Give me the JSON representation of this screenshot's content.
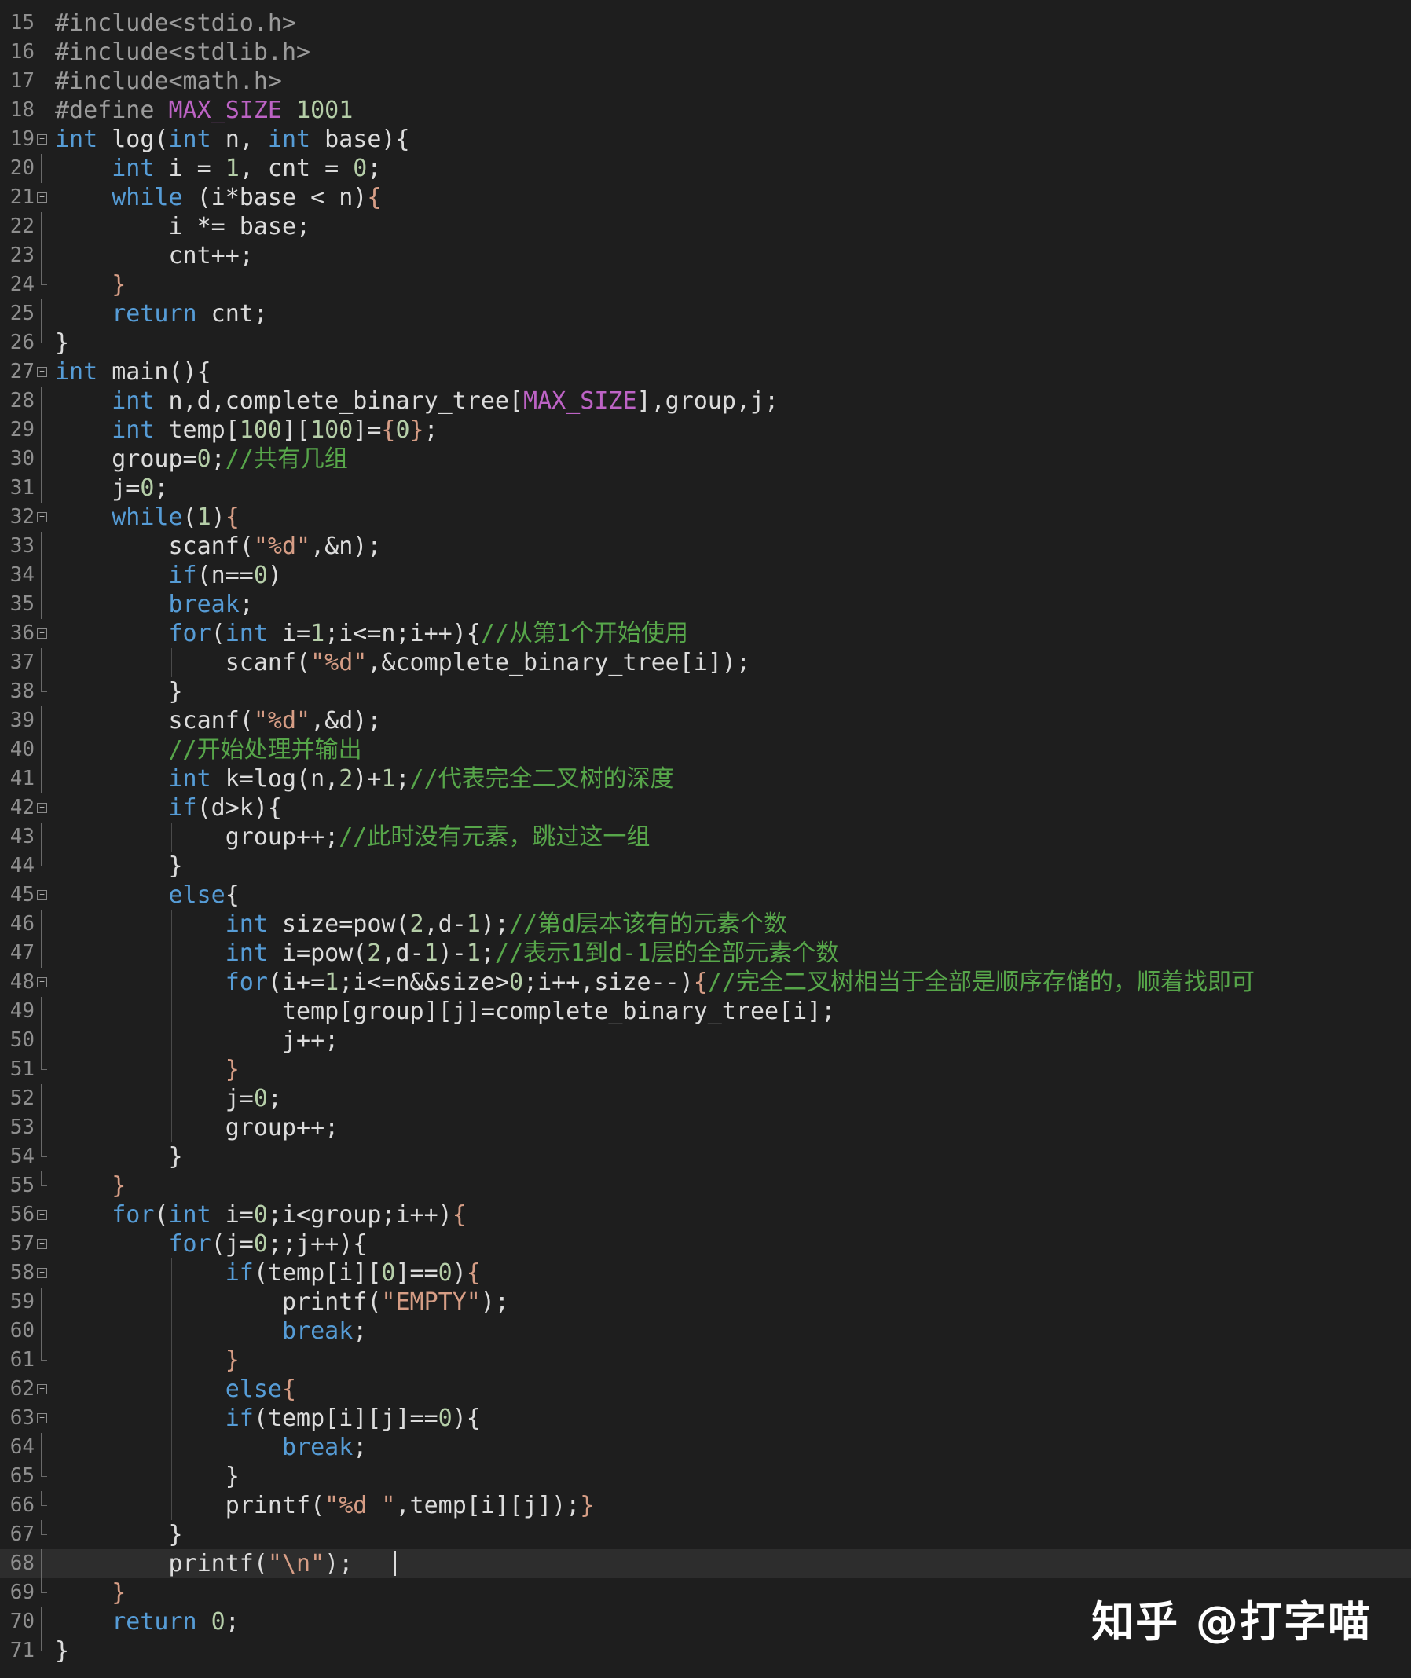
{
  "editor": {
    "lines": [
      {
        "num": "15",
        "fold": "",
        "indent": 0,
        "segments": [
          [
            "pr",
            "#include<stdio.h>"
          ]
        ]
      },
      {
        "num": "16",
        "fold": "",
        "indent": 0,
        "segments": [
          [
            "pr",
            "#include<stdlib.h>"
          ]
        ]
      },
      {
        "num": "17",
        "fold": "",
        "indent": 0,
        "segments": [
          [
            "pr",
            "#include<math.h>"
          ]
        ]
      },
      {
        "num": "18",
        "fold": "",
        "indent": 0,
        "segments": [
          [
            "pr",
            "#define "
          ],
          [
            "m",
            "MAX_SIZE"
          ],
          [
            "pr",
            " "
          ],
          [
            "n",
            "1001"
          ]
        ]
      },
      {
        "num": "19",
        "fold": "open",
        "indent": 0,
        "segments": [
          [
            "k",
            "int"
          ],
          [
            "t",
            " log("
          ],
          [
            "k",
            "int"
          ],
          [
            "t",
            " n, "
          ],
          [
            "k",
            "int"
          ],
          [
            "t",
            " base){"
          ]
        ]
      },
      {
        "num": "20",
        "fold": "bar",
        "indent": 1,
        "segments": [
          [
            "k",
            "int"
          ],
          [
            "t",
            " i = "
          ],
          [
            "n",
            "1"
          ],
          [
            "t",
            ", cnt = "
          ],
          [
            "n",
            "0"
          ],
          [
            "t",
            ";"
          ]
        ]
      },
      {
        "num": "21",
        "fold": "open",
        "indent": 1,
        "segments": [
          [
            "k",
            "while"
          ],
          [
            "t",
            " (i*base < n)"
          ],
          [
            "s",
            "{"
          ]
        ]
      },
      {
        "num": "22",
        "fold": "bar",
        "indent": 2,
        "segments": [
          [
            "t",
            "i *= base;"
          ]
        ]
      },
      {
        "num": "23",
        "fold": "bar",
        "indent": 2,
        "segments": [
          [
            "t",
            "cnt++;"
          ]
        ]
      },
      {
        "num": "24",
        "fold": "end",
        "indent": 1,
        "segments": [
          [
            "s",
            "}"
          ]
        ]
      },
      {
        "num": "25",
        "fold": "bar",
        "indent": 1,
        "segments": [
          [
            "k",
            "return"
          ],
          [
            "t",
            " cnt;"
          ]
        ]
      },
      {
        "num": "26",
        "fold": "end",
        "indent": 0,
        "segments": [
          [
            "t",
            "}"
          ]
        ]
      },
      {
        "num": "27",
        "fold": "open",
        "indent": 0,
        "segments": [
          [
            "k",
            "int"
          ],
          [
            "t",
            " main(){"
          ]
        ]
      },
      {
        "num": "28",
        "fold": "bar",
        "indent": 1,
        "segments": [
          [
            "k",
            "int"
          ],
          [
            "t",
            " n,d,complete_binary_tree["
          ],
          [
            "m",
            "MAX_SIZE"
          ],
          [
            "t",
            "],group,j;"
          ]
        ]
      },
      {
        "num": "29",
        "fold": "bar",
        "indent": 1,
        "segments": [
          [
            "k",
            "int"
          ],
          [
            "t",
            " temp["
          ],
          [
            "n",
            "100"
          ],
          [
            "t",
            "]["
          ],
          [
            "n",
            "100"
          ],
          [
            "t",
            "]="
          ],
          [
            "s",
            "{"
          ],
          [
            "n",
            "0"
          ],
          [
            "s",
            "}"
          ],
          [
            "t",
            ";"
          ]
        ]
      },
      {
        "num": "30",
        "fold": "bar",
        "indent": 1,
        "segments": [
          [
            "t",
            "group="
          ],
          [
            "n",
            "0"
          ],
          [
            "t",
            ";"
          ],
          [
            "c",
            "//共有几组"
          ]
        ]
      },
      {
        "num": "31",
        "fold": "bar",
        "indent": 1,
        "segments": [
          [
            "t",
            "j="
          ],
          [
            "n",
            "0"
          ],
          [
            "t",
            ";"
          ]
        ]
      },
      {
        "num": "32",
        "fold": "open",
        "indent": 1,
        "segments": [
          [
            "k",
            "while"
          ],
          [
            "t",
            "("
          ],
          [
            "n",
            "1"
          ],
          [
            "t",
            ")"
          ],
          [
            "s",
            "{"
          ]
        ]
      },
      {
        "num": "33",
        "fold": "bar",
        "indent": 2,
        "segments": [
          [
            "t",
            "scanf("
          ],
          [
            "s",
            "\"%d\""
          ],
          [
            "t",
            ",&n);"
          ]
        ]
      },
      {
        "num": "34",
        "fold": "bar",
        "indent": 2,
        "segments": [
          [
            "k",
            "if"
          ],
          [
            "t",
            "(n=="
          ],
          [
            "n",
            "0"
          ],
          [
            "t",
            ")"
          ]
        ]
      },
      {
        "num": "35",
        "fold": "bar",
        "indent": 2,
        "segments": [
          [
            "k",
            "break"
          ],
          [
            "t",
            ";"
          ]
        ]
      },
      {
        "num": "36",
        "fold": "open",
        "indent": 2,
        "segments": [
          [
            "k",
            "for"
          ],
          [
            "t",
            "("
          ],
          [
            "k",
            "int"
          ],
          [
            "t",
            " i="
          ],
          [
            "n",
            "1"
          ],
          [
            "t",
            ";i<=n;i++){"
          ],
          [
            "c",
            "//从第1个开始使用"
          ]
        ]
      },
      {
        "num": "37",
        "fold": "bar",
        "indent": 3,
        "segments": [
          [
            "t",
            "scanf("
          ],
          [
            "s",
            "\"%d\""
          ],
          [
            "t",
            ",&complete_binary_tree[i]);"
          ]
        ]
      },
      {
        "num": "38",
        "fold": "end",
        "indent": 2,
        "segments": [
          [
            "t",
            "}"
          ]
        ]
      },
      {
        "num": "39",
        "fold": "bar",
        "indent": 2,
        "segments": [
          [
            "t",
            "scanf("
          ],
          [
            "s",
            "\"%d\""
          ],
          [
            "t",
            ",&d);"
          ]
        ]
      },
      {
        "num": "40",
        "fold": "bar",
        "indent": 2,
        "segments": [
          [
            "c",
            "//开始处理并输出"
          ]
        ]
      },
      {
        "num": "41",
        "fold": "bar",
        "indent": 2,
        "segments": [
          [
            "k",
            "int"
          ],
          [
            "t",
            " k=log(n,"
          ],
          [
            "n",
            "2"
          ],
          [
            "t",
            ")+"
          ],
          [
            "n",
            "1"
          ],
          [
            "t",
            ";"
          ],
          [
            "c",
            "//代表完全二叉树的深度"
          ]
        ]
      },
      {
        "num": "42",
        "fold": "open",
        "indent": 2,
        "segments": [
          [
            "k",
            "if"
          ],
          [
            "t",
            "(d>k){"
          ]
        ]
      },
      {
        "num": "43",
        "fold": "bar",
        "indent": 3,
        "segments": [
          [
            "t",
            "group++;"
          ],
          [
            "c",
            "//此时没有元素，跳过这一组"
          ]
        ]
      },
      {
        "num": "44",
        "fold": "end",
        "indent": 2,
        "segments": [
          [
            "t",
            "}"
          ]
        ]
      },
      {
        "num": "45",
        "fold": "open",
        "indent": 2,
        "segments": [
          [
            "k",
            "else"
          ],
          [
            "t",
            "{"
          ]
        ]
      },
      {
        "num": "46",
        "fold": "bar",
        "indent": 3,
        "segments": [
          [
            "k",
            "int"
          ],
          [
            "t",
            " size=pow("
          ],
          [
            "n",
            "2"
          ],
          [
            "t",
            ",d-"
          ],
          [
            "n",
            "1"
          ],
          [
            "t",
            ");"
          ],
          [
            "c",
            "//第d层本该有的元素个数"
          ]
        ]
      },
      {
        "num": "47",
        "fold": "bar",
        "indent": 3,
        "segments": [
          [
            "k",
            "int"
          ],
          [
            "t",
            " i=pow("
          ],
          [
            "n",
            "2"
          ],
          [
            "t",
            ",d-"
          ],
          [
            "n",
            "1"
          ],
          [
            "t",
            ")-"
          ],
          [
            "n",
            "1"
          ],
          [
            "t",
            ";"
          ],
          [
            "c",
            "//表示1到d-1层的全部元素个数"
          ]
        ]
      },
      {
        "num": "48",
        "fold": "open",
        "indent": 3,
        "segments": [
          [
            "k",
            "for"
          ],
          [
            "t",
            "(i+="
          ],
          [
            "n",
            "1"
          ],
          [
            "t",
            ";i<=n&&size>"
          ],
          [
            "n",
            "0"
          ],
          [
            "t",
            ";i++,size--)"
          ],
          [
            "s",
            "{"
          ],
          [
            "c",
            "//完全二叉树相当于全部是顺序存储的，顺着找即可"
          ]
        ]
      },
      {
        "num": "49",
        "fold": "bar",
        "indent": 4,
        "segments": [
          [
            "t",
            "temp[group][j]=complete_binary_tree[i];"
          ]
        ]
      },
      {
        "num": "50",
        "fold": "bar",
        "indent": 4,
        "segments": [
          [
            "t",
            "j++;"
          ]
        ]
      },
      {
        "num": "51",
        "fold": "end",
        "indent": 3,
        "segments": [
          [
            "s",
            "}"
          ]
        ]
      },
      {
        "num": "52",
        "fold": "bar",
        "indent": 3,
        "segments": [
          [
            "t",
            "j="
          ],
          [
            "n",
            "0"
          ],
          [
            "t",
            ";"
          ]
        ]
      },
      {
        "num": "53",
        "fold": "bar",
        "indent": 3,
        "segments": [
          [
            "t",
            "group++;"
          ]
        ]
      },
      {
        "num": "54",
        "fold": "end",
        "indent": 2,
        "segments": [
          [
            "t",
            "}"
          ]
        ]
      },
      {
        "num": "55",
        "fold": "end",
        "indent": 1,
        "segments": [
          [
            "s",
            "}"
          ]
        ]
      },
      {
        "num": "56",
        "fold": "open",
        "indent": 1,
        "segments": [
          [
            "k",
            "for"
          ],
          [
            "t",
            "("
          ],
          [
            "k",
            "int"
          ],
          [
            "t",
            " i="
          ],
          [
            "n",
            "0"
          ],
          [
            "t",
            ";i<group;i++)"
          ],
          [
            "s",
            "{"
          ]
        ]
      },
      {
        "num": "57",
        "fold": "open",
        "indent": 2,
        "segments": [
          [
            "k",
            "for"
          ],
          [
            "t",
            "(j="
          ],
          [
            "n",
            "0"
          ],
          [
            "t",
            ";;j++){"
          ]
        ]
      },
      {
        "num": "58",
        "fold": "open",
        "indent": 3,
        "segments": [
          [
            "k",
            "if"
          ],
          [
            "t",
            "(temp[i]["
          ],
          [
            "n",
            "0"
          ],
          [
            "t",
            "]=="
          ],
          [
            "n",
            "0"
          ],
          [
            "t",
            ")"
          ],
          [
            "s",
            "{"
          ]
        ]
      },
      {
        "num": "59",
        "fold": "bar",
        "indent": 4,
        "segments": [
          [
            "t",
            "printf("
          ],
          [
            "s",
            "\"EMPTY\""
          ],
          [
            "t",
            ");"
          ]
        ]
      },
      {
        "num": "60",
        "fold": "bar",
        "indent": 4,
        "segments": [
          [
            "k",
            "break"
          ],
          [
            "t",
            ";"
          ]
        ]
      },
      {
        "num": "61",
        "fold": "end",
        "indent": 3,
        "segments": [
          [
            "s",
            "}"
          ]
        ]
      },
      {
        "num": "62",
        "fold": "open",
        "indent": 3,
        "segments": [
          [
            "k",
            "else"
          ],
          [
            "s",
            "{"
          ]
        ]
      },
      {
        "num": "63",
        "fold": "open",
        "indent": 3,
        "segments": [
          [
            "k",
            "if"
          ],
          [
            "t",
            "(temp[i][j]=="
          ],
          [
            "n",
            "0"
          ],
          [
            "t",
            "){"
          ]
        ]
      },
      {
        "num": "64",
        "fold": "bar",
        "indent": 4,
        "segments": [
          [
            "k",
            "break"
          ],
          [
            "t",
            ";"
          ]
        ]
      },
      {
        "num": "65",
        "fold": "end",
        "indent": 3,
        "segments": [
          [
            "t",
            "}"
          ]
        ]
      },
      {
        "num": "66",
        "fold": "end",
        "indent": 3,
        "segments": [
          [
            "t",
            "printf("
          ],
          [
            "s",
            "\"%d \""
          ],
          [
            "t",
            ",temp[i][j]);"
          ],
          [
            "s",
            "}"
          ]
        ]
      },
      {
        "num": "67",
        "fold": "end",
        "indent": 2,
        "segments": [
          [
            "t",
            "}"
          ]
        ]
      },
      {
        "num": "68",
        "fold": "bar",
        "indent": 2,
        "current": true,
        "segments": [
          [
            "t",
            "printf("
          ],
          [
            "s",
            "\"\\n\""
          ],
          [
            "t",
            ");"
          ]
        ]
      },
      {
        "num": "69",
        "fold": "end",
        "indent": 1,
        "segments": [
          [
            "s",
            "}"
          ]
        ]
      },
      {
        "num": "70",
        "fold": "bar",
        "indent": 1,
        "segments": [
          [
            "k",
            "return"
          ],
          [
            "t",
            " "
          ],
          [
            "n",
            "0"
          ],
          [
            "t",
            ";"
          ]
        ]
      },
      {
        "num": "71",
        "fold": "end",
        "indent": 0,
        "segments": [
          [
            "t",
            "}"
          ]
        ]
      }
    ]
  },
  "watermark": {
    "text": "知乎 @打字喵"
  },
  "colors": {
    "background": "#1e1e1e",
    "keyword": "#569cd6",
    "preprocessor": "#9b9b9b",
    "string": "#d69d85",
    "number": "#b5cea8",
    "comment": "#57a64a",
    "macro": "#bd63c5",
    "text": "#dcdcdc"
  }
}
